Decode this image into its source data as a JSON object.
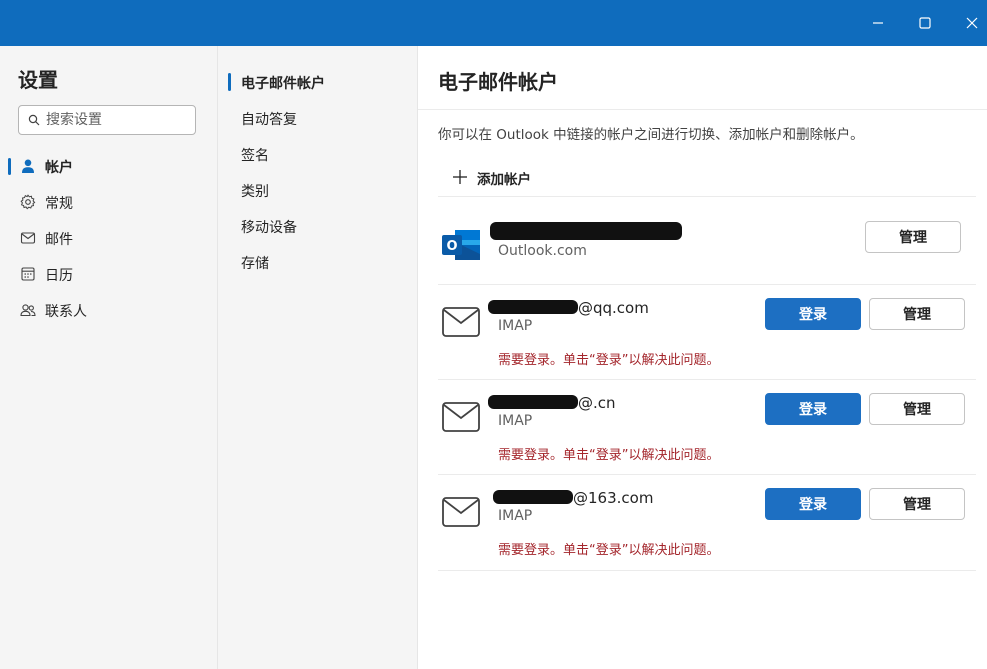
{
  "window": {
    "controls": {
      "minimize_icon": "minimize-icon",
      "maximize_icon": "maximize-icon",
      "close_icon": "close-icon"
    },
    "accent": "#0f6cbd"
  },
  "sidebar": {
    "title": "设置",
    "search": {
      "placeholder": "搜索设置",
      "value": ""
    },
    "items": [
      {
        "label": "帐户",
        "icon": "person-icon",
        "active": true
      },
      {
        "label": "常规",
        "icon": "gear-icon",
        "active": false
      },
      {
        "label": "邮件",
        "icon": "mail-icon",
        "active": false
      },
      {
        "label": "日历",
        "icon": "calendar-icon",
        "active": false
      },
      {
        "label": "联系人",
        "icon": "people-icon",
        "active": false
      }
    ]
  },
  "subnav": {
    "items": [
      {
        "label": "电子邮件帐户",
        "active": true
      },
      {
        "label": "自动答复",
        "active": false
      },
      {
        "label": "签名",
        "active": false
      },
      {
        "label": "类别",
        "active": false
      },
      {
        "label": "移动设备",
        "active": false
      },
      {
        "label": "存储",
        "active": false
      }
    ]
  },
  "main": {
    "title": "电子邮件帐户",
    "description": "你可以在 Outlook 中链接的帐户之间进行切换、添加帐户和删除帐户。",
    "add_account_label": "添加帐户",
    "accounts": [
      {
        "name": "",
        "type": "Outlook.com",
        "icon": "outlook-logo-icon",
        "manage_label": "管理"
      },
      {
        "name": "@qq.com",
        "type": "IMAP",
        "icon": "mail-icon",
        "error": "需要登录。单击“登录”以解决此问题。",
        "signin_label": "登录",
        "manage_label": "管理"
      },
      {
        "name": "@.cn",
        "type": "IMAP",
        "icon": "mail-icon",
        "error": "需要登录。单击“登录”以解决此问题。",
        "signin_label": "登录",
        "manage_label": "管理"
      },
      {
        "name": "@163.com",
        "type": "IMAP",
        "icon": "mail-icon",
        "error": "需要登录。单击“登录”以解决此问题。",
        "signin_label": "登录",
        "manage_label": "管理"
      }
    ],
    "colors": {
      "primary_button": "#1d6fc2",
      "error_text": "#a4262c"
    }
  }
}
